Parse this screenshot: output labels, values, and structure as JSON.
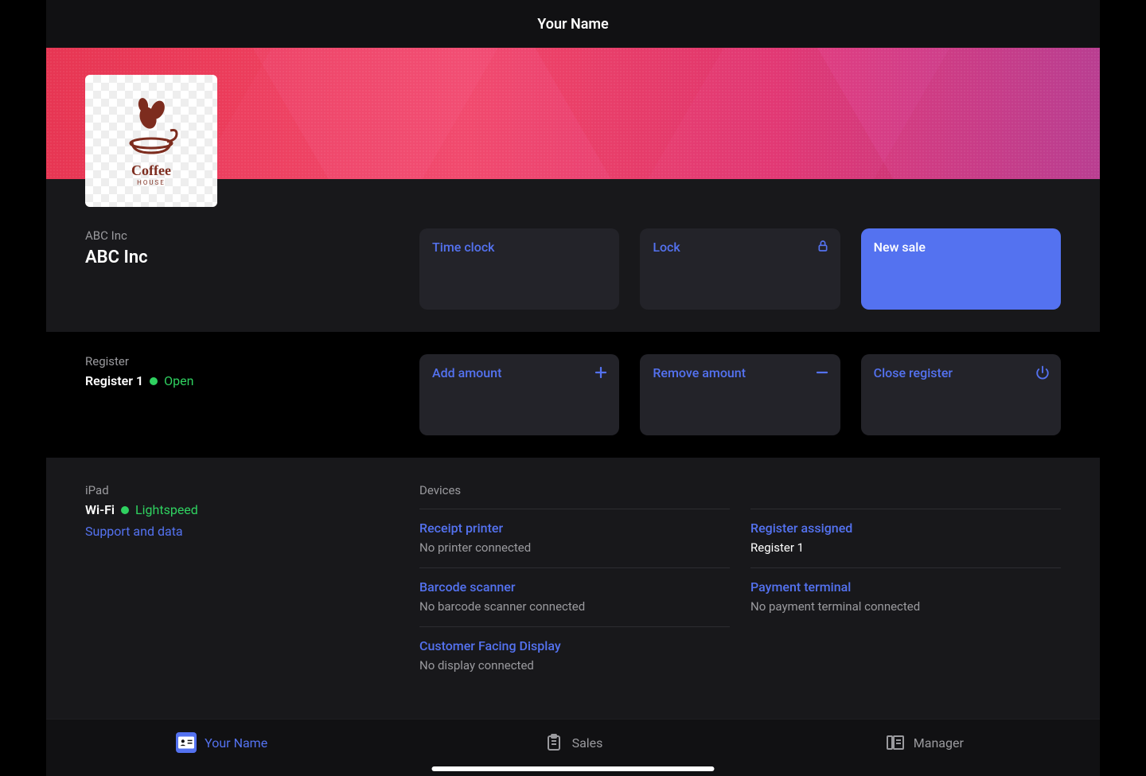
{
  "header": {
    "title": "Your Name"
  },
  "company": {
    "sub": "ABC Inc",
    "name": "ABC Inc",
    "logo_text": "Coffee",
    "logo_sub": "HOUSE"
  },
  "actions": {
    "time_clock": "Time clock",
    "lock": "Lock",
    "new_sale": "New sale"
  },
  "register": {
    "label": "Register",
    "name": "Register 1",
    "status": "Open",
    "add_amount": "Add amount",
    "remove_amount": "Remove amount",
    "close_register": "Close register"
  },
  "ipad": {
    "label": "iPad",
    "wifi_label": "Wi-Fi",
    "wifi_name": "Lightspeed",
    "support": "Support and data"
  },
  "devices": {
    "header": "Devices",
    "items": [
      {
        "title": "Receipt printer",
        "sub": "No printer connected"
      },
      {
        "title": "Register assigned",
        "sub": "Register 1",
        "sub_white": true
      },
      {
        "title": "Barcode scanner",
        "sub": "No barcode scanner connected"
      },
      {
        "title": "Payment terminal",
        "sub": "No payment terminal connected"
      },
      {
        "title": "Customer Facing Display",
        "sub": "No display connected"
      }
    ]
  },
  "nav": {
    "profile": "Your Name",
    "sales": "Sales",
    "manager": "Manager"
  }
}
